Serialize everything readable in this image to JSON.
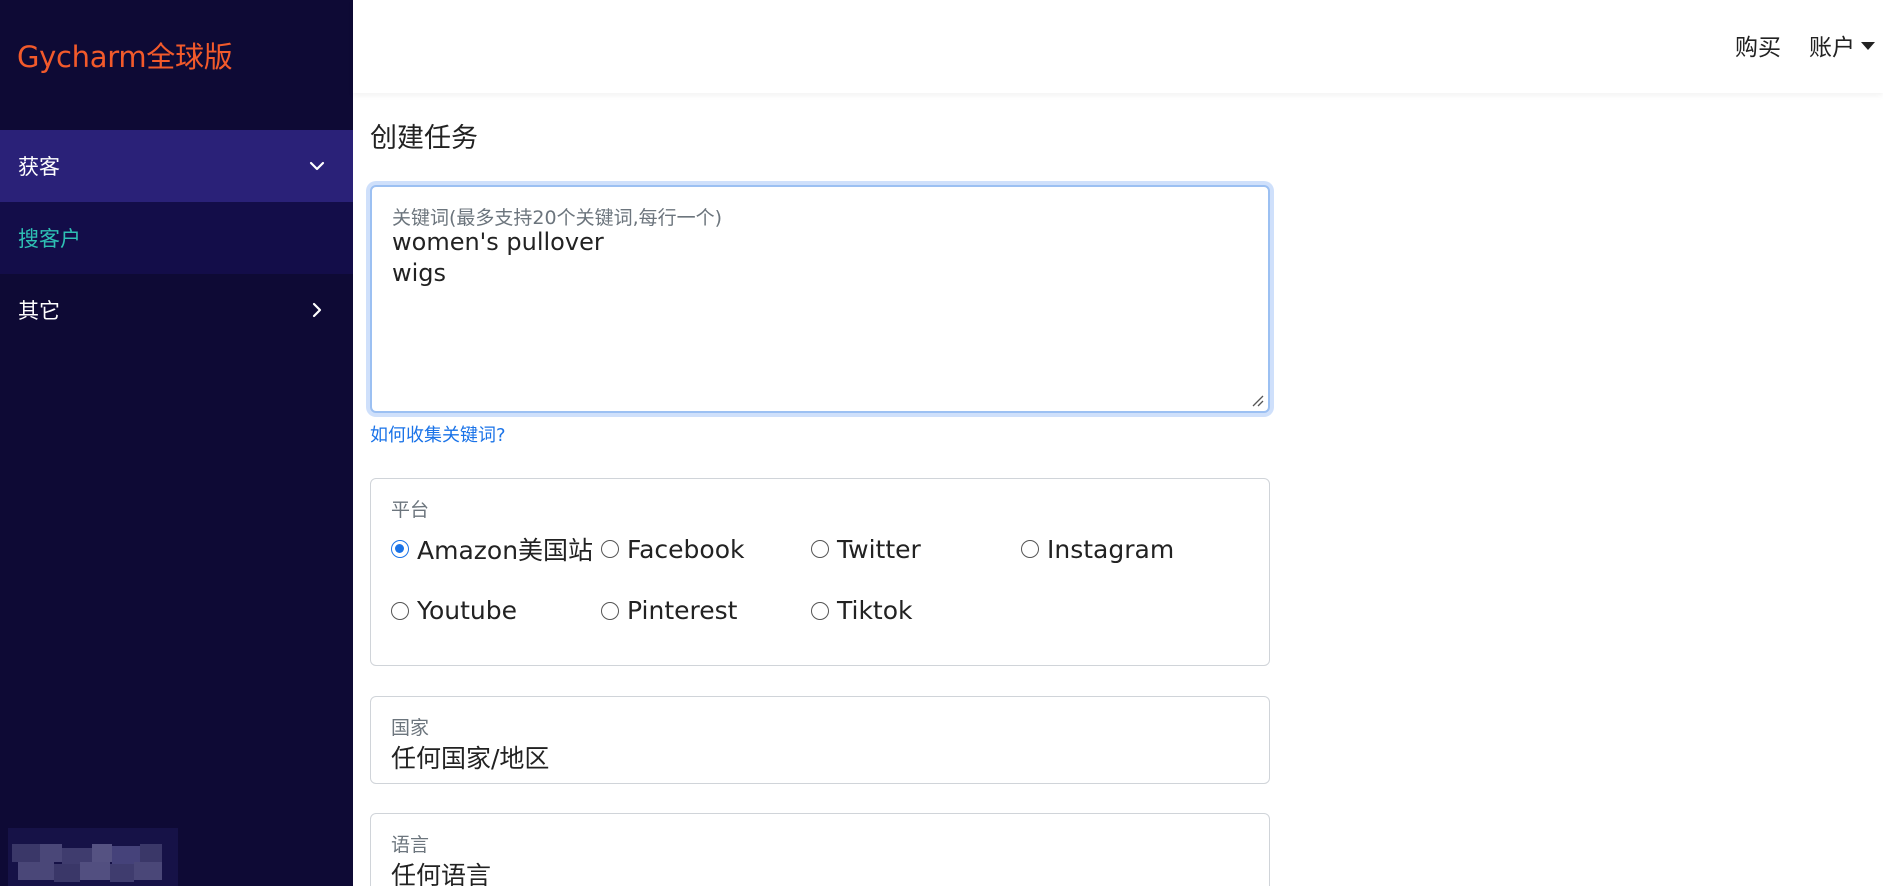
{
  "sidebar": {
    "brand": "Gycharm全球版",
    "group_label": "获客",
    "sub_item_label": "搜客户",
    "other_label": "其它"
  },
  "header": {
    "buy_label": "购买",
    "account_label": "账户"
  },
  "main": {
    "title": "创建任务",
    "keywords": {
      "label": "关键词(最多支持20个关键词,每行一个)",
      "value": "women's pullover\nwigs"
    },
    "help_link": "如何收集关键词?",
    "platform": {
      "label": "平台",
      "options": [
        "Amazon美国站",
        "Facebook",
        "Twitter",
        "Instagram",
        "Youtube",
        "Pinterest",
        "Tiktok"
      ],
      "selected": "Amazon美国站"
    },
    "country": {
      "label": "国家",
      "value": "任何国家/地区"
    },
    "language": {
      "label": "语言",
      "value": "任何语言"
    }
  },
  "colors": {
    "sidebar_bg": "#0e0a35",
    "sidebar_active": "#2a2178",
    "brand": "#f25a2b",
    "sub_item": "#2ec0b4",
    "link": "#1a73e8"
  }
}
